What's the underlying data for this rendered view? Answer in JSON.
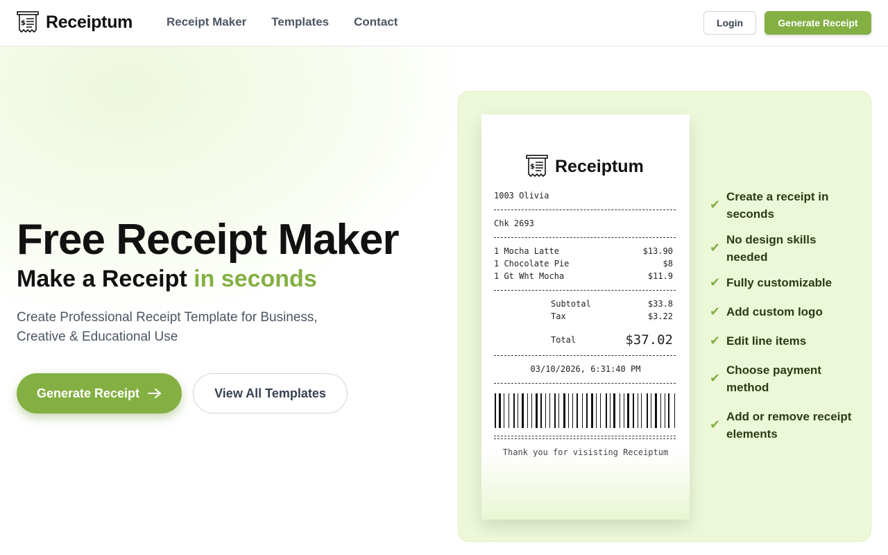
{
  "header": {
    "brand": "Receiptum",
    "nav": [
      "Receipt Maker",
      "Templates",
      "Contact"
    ],
    "login_label": "Login",
    "generate_label": "Generate Receipt"
  },
  "hero": {
    "title": "Free Receipt Maker",
    "subtitle_start": "Make a Receipt ",
    "subtitle_accent": "in seconds",
    "description": "Create Professional Receipt Template for Business, Creative & Educational Use",
    "primary_cta": "Generate Receipt",
    "secondary_cta": "View All Templates"
  },
  "receipt": {
    "brand": "Receiptum",
    "server": "1003 Olivia",
    "check": "Chk 2693",
    "items": [
      {
        "name": "1 Mocha Latte",
        "price": "$13.90"
      },
      {
        "name": "1 Chocolate Pie",
        "price": "$8"
      },
      {
        "name": "1 Gt Wht Mocha",
        "price": "$11.9"
      }
    ],
    "subtotal_label": "Subtotal",
    "subtotal": "$33.8",
    "tax_label": "Tax",
    "tax": "$3.22",
    "total_label": "Total",
    "total": "$37.02",
    "datetime": "03/10/2026, 6:31:40 PM",
    "thanks": "Thank you for visisting Receiptum"
  },
  "features": [
    "Create a receipt in seconds",
    "No design skills needed",
    "Fully customizable",
    "Add custom logo",
    "Edit line items",
    "Choose payment method",
    "Add or remove receipt elements"
  ],
  "icons": {
    "logo": "receipt-logo-icon",
    "arrow": "arrow-right-icon",
    "check": "check-icon"
  },
  "colors": {
    "accent": "#84b043",
    "panel": "#edf8d9",
    "feature_text": "#2b3a12"
  }
}
